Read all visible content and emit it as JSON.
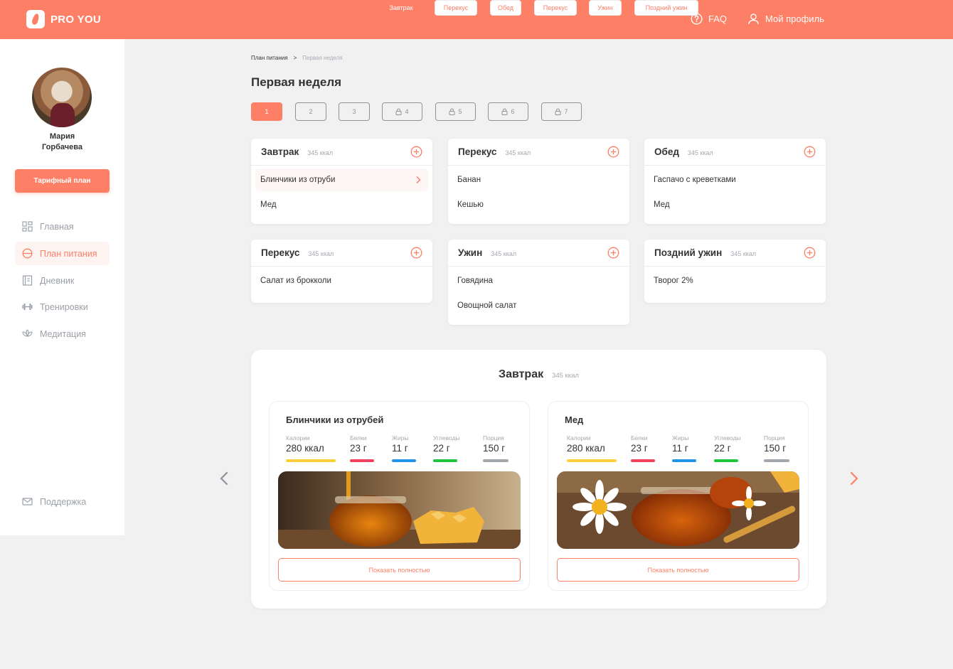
{
  "header": {
    "brand": "PRO YOU",
    "faq": "FAQ",
    "profile": "Мой профиль"
  },
  "sidebar": {
    "user_name_first": "Мария",
    "user_name_last": "Горбачева",
    "plan_button": "Тарифный план",
    "items": [
      {
        "label": "Главная",
        "icon": "grid-icon"
      },
      {
        "label": "План питания",
        "icon": "plate-icon",
        "active": true
      },
      {
        "label": "Дневник",
        "icon": "notebook-icon"
      },
      {
        "label": "Тренировки",
        "icon": "dumbbell-icon"
      },
      {
        "label": "Медитация",
        "icon": "lotus-icon"
      }
    ],
    "support": "Поддержка"
  },
  "breadcrumb": {
    "root": "План питания",
    "separator": ">",
    "current": "Первая неделя"
  },
  "page_title": "Первая неделя",
  "days": [
    {
      "label": "1",
      "locked": false,
      "active": true
    },
    {
      "label": "2",
      "locked": false
    },
    {
      "label": "3",
      "locked": false
    },
    {
      "label": "4",
      "locked": true
    },
    {
      "label": "5",
      "locked": true
    },
    {
      "label": "6",
      "locked": true
    },
    {
      "label": "7",
      "locked": true
    }
  ],
  "meals": [
    {
      "title": "Завтрак",
      "kcal": "345 ккал",
      "items": [
        "Блинчики из отруби",
        "Мед"
      ]
    },
    {
      "title": "Перекус",
      "kcal": "345 ккал",
      "items": [
        "Банан",
        "Кешью"
      ]
    },
    {
      "title": "Обед",
      "kcal": "345 ккал",
      "items": [
        "Гаспачо с креветками",
        "Мед"
      ]
    },
    {
      "title": "Перекус",
      "kcal": "345 ккал",
      "items": [
        "Салат из брокколи"
      ]
    },
    {
      "title": "Ужин",
      "kcal": "345 ккал",
      "items": [
        "Говядина",
        "Овощной салат"
      ]
    },
    {
      "title": "Поздний ужин",
      "kcal": "345 ккал",
      "items": [
        "Творог 2%"
      ]
    }
  ],
  "detail": {
    "title": "Завтрак",
    "kcal": "345 ккал",
    "foods": [
      {
        "name": "Блинчики из отрубей",
        "nutrients": [
          {
            "label": "Калории",
            "value": "280 ккал",
            "color": "#f9cf3b"
          },
          {
            "label": "Белки",
            "value": "23 г",
            "color": "#f0425b"
          },
          {
            "label": "Жиры",
            "value": "11 г",
            "color": "#1e95e6"
          },
          {
            "label": "Углеводы",
            "value": "22 г",
            "color": "#1ec53a"
          },
          {
            "label": "Порция",
            "value": "150 г",
            "color": "#a3a8af"
          }
        ],
        "button": "Показать полностью"
      },
      {
        "name": "Мед",
        "nutrients": [
          {
            "label": "Калории",
            "value": "280 ккал",
            "color": "#f9cf3b"
          },
          {
            "label": "Белки",
            "value": "23 г",
            "color": "#f0425b"
          },
          {
            "label": "Жиры",
            "value": "11 г",
            "color": "#1e95e6"
          },
          {
            "label": "Углеводы",
            "value": "22 г",
            "color": "#1ec53a"
          },
          {
            "label": "Порция",
            "value": "150 г",
            "color": "#a3a8af"
          }
        ],
        "button": "Показать полностью"
      }
    ]
  },
  "meal_tabs": [
    {
      "label": "Завтрак",
      "active": true
    },
    {
      "label": "Перекус"
    },
    {
      "label": "Обед"
    },
    {
      "label": "Перекус"
    },
    {
      "label": "Ужин"
    },
    {
      "label": "Поздний ужин"
    }
  ],
  "colors": {
    "accent": "#fd7f66",
    "muted": "#9ba0a8"
  }
}
